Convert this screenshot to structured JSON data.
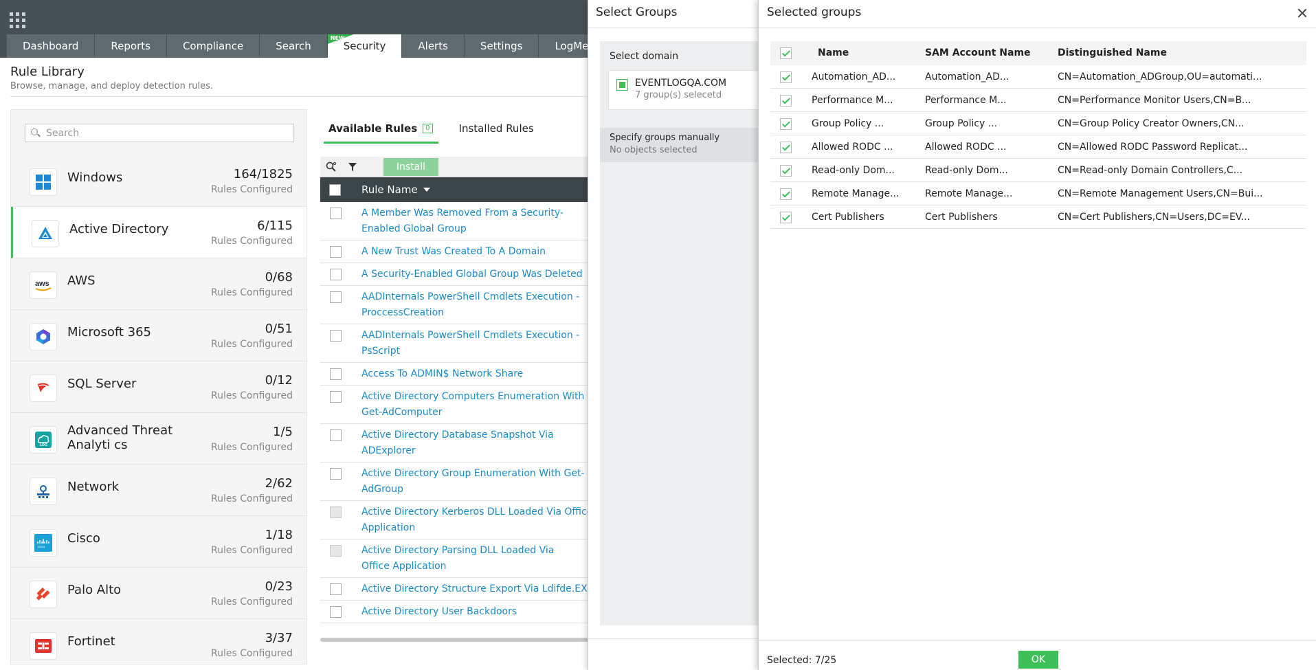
{
  "header": {
    "tabs": [
      {
        "label": "Dashboard"
      },
      {
        "label": "Reports"
      },
      {
        "label": "Compliance"
      },
      {
        "label": "Search"
      },
      {
        "label": "Security",
        "badge": "NEW",
        "active": true
      },
      {
        "label": "Alerts"
      },
      {
        "label": "Settings"
      },
      {
        "label": "LogMe"
      }
    ]
  },
  "page": {
    "title": "Rule Library",
    "subtitle": "Browse, manage, and deploy detection rules."
  },
  "sidebar": {
    "search_placeholder": "Search",
    "rules_configured_label": "Rules Configured",
    "items": [
      {
        "name": "Windows",
        "count": "164/1825",
        "icon": "windows-icon"
      },
      {
        "name": "Active Directory",
        "count": "6/115",
        "icon": "active-directory-icon",
        "active": true
      },
      {
        "name": "AWS",
        "count": "0/68",
        "icon": "aws-icon"
      },
      {
        "name": "Microsoft 365",
        "count": "0/51",
        "icon": "microsoft-365-icon"
      },
      {
        "name": "SQL Server",
        "count": "0/12",
        "icon": "sql-server-icon"
      },
      {
        "name": "Advanced Threat Analyti cs",
        "count": "1/5",
        "icon": "ata-log-icon"
      },
      {
        "name": "Network",
        "count": "2/62",
        "icon": "network-icon"
      },
      {
        "name": "Cisco",
        "count": "1/18",
        "icon": "cisco-icon"
      },
      {
        "name": "Palo Alto",
        "count": "0/23",
        "icon": "palo-alto-icon"
      },
      {
        "name": "Fortinet",
        "count": "3/37",
        "icon": "fortinet-icon"
      }
    ]
  },
  "rules": {
    "tabs": {
      "available": "Available Rules",
      "available_count": "0",
      "installed": "Installed Rules"
    },
    "install_label": "Install",
    "column_header": "Rule Name",
    "items": [
      {
        "text": "A Member Was Removed From a Security-Enabled Global Group"
      },
      {
        "text": "A New Trust Was Created To A Domain"
      },
      {
        "text": "A Security-Enabled Global Group Was Deleted"
      },
      {
        "text": "AADInternals PowerShell Cmdlets Execution - ProccessCreation"
      },
      {
        "text": "AADInternals PowerShell Cmdlets Execution - PsScript"
      },
      {
        "text": "Access To ADMIN$ Network Share"
      },
      {
        "text": "Active Directory Computers Enumeration With Get-AdComputer"
      },
      {
        "text": "Active Directory Database Snapshot Via ADExplorer"
      },
      {
        "text": "Active Directory Group Enumeration With Get-AdGroup"
      },
      {
        "text": "Active Directory Kerberos DLL Loaded Via Office Application",
        "disabled": true
      },
      {
        "text": "Active Directory Parsing DLL Loaded Via Office Application",
        "disabled": true
      },
      {
        "text": "Active Directory Structure Export Via Ldifde.EXE"
      },
      {
        "text": "Active Directory User Backdoors"
      }
    ]
  },
  "select_groups": {
    "title": "Select Groups",
    "select_domain_label": "Select domain",
    "domain_name": "EVENTLOGQA.COM",
    "domain_count": "7 group(s) selecetd",
    "manual_label": "Specify groups manually",
    "manual_value": "No objects selected"
  },
  "selected_groups": {
    "title": "Selected groups",
    "columns": {
      "name": "Name",
      "sam": "SAM Account Name",
      "dn": "Distinguished Name"
    },
    "rows": [
      {
        "name": "Automation_AD...",
        "sam": "Automation_AD...",
        "dn": "CN=Automation_ADGroup,OU=automati..."
      },
      {
        "name": "Performance M...",
        "sam": "Performance M...",
        "dn": "CN=Performance Monitor Users,CN=B..."
      },
      {
        "name": "Group Policy ...",
        "sam": "Group Policy ...",
        "dn": "CN=Group Policy Creator Owners,CN..."
      },
      {
        "name": "Allowed RODC ...",
        "sam": "Allowed RODC ...",
        "dn": "CN=Allowed RODC Password Replicat..."
      },
      {
        "name": "Read-only Dom...",
        "sam": "Read-only Dom...",
        "dn": "CN=Read-only Domain Controllers,C..."
      },
      {
        "name": "Remote Manage...",
        "sam": "Remote Manage...",
        "dn": "CN=Remote Management Users,CN=Bui..."
      },
      {
        "name": "Cert Publishers",
        "sam": "Cert Publishers",
        "dn": "CN=Cert Publishers,CN=Users,DC=EV..."
      }
    ],
    "selected_count": "Selected: 7/25",
    "ok_label": "OK"
  },
  "colors": {
    "accent": "#3fbf5a",
    "header_bg": "#475154",
    "link": "#1a8bc8"
  }
}
